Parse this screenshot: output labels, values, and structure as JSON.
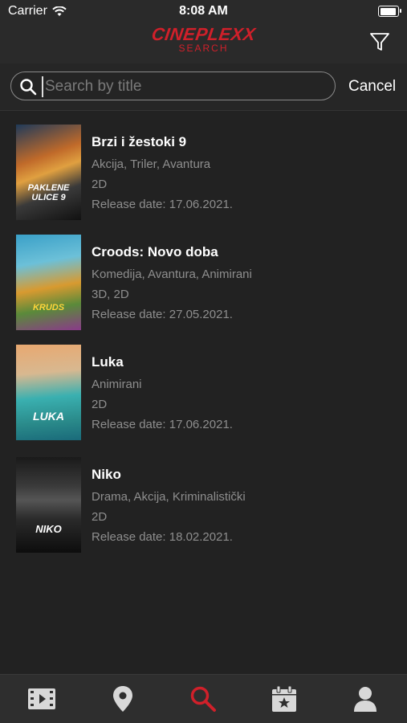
{
  "status": {
    "carrier": "Carrier",
    "time": "8:08 AM"
  },
  "header": {
    "logo": "CINEPLEXX",
    "subtitle": "SEARCH",
    "brand_color": "#d0202a",
    "filter_icon": "filter-icon"
  },
  "search": {
    "value": "",
    "placeholder": "Search by title",
    "cancel_label": "Cancel"
  },
  "movies": [
    {
      "title": "Brzi i žestoki 9",
      "genres": "Akcija, Triler, Avantura",
      "format": "2D",
      "release": "Release date: 17.06.2021.",
      "poster_text": "PAKLENE ULICE 9"
    },
    {
      "title": "Croods: Novo doba",
      "genres": "Komedija, Avantura, Animirani",
      "format": "3D, 2D",
      "release": "Release date: 27.05.2021.",
      "poster_text": "KRUDS"
    },
    {
      "title": "Luka",
      "genres": "Animirani",
      "format": "2D",
      "release": "Release date: 17.06.2021.",
      "poster_text": "LUKA"
    },
    {
      "title": "Niko",
      "genres": "Drama, Akcija, Kriminalistički",
      "format": "2D",
      "release": "Release date: 18.02.2021.",
      "poster_text": "NIKO"
    }
  ],
  "tabs": [
    {
      "icon": "film-icon",
      "active": false
    },
    {
      "icon": "location-pin-icon",
      "active": false
    },
    {
      "icon": "search-icon",
      "active": true
    },
    {
      "icon": "calendar-star-icon",
      "active": false
    },
    {
      "icon": "user-icon",
      "active": false
    }
  ],
  "colors": {
    "active_tab": "#d0202a",
    "inactive_tab": "#d8d8d8",
    "background": "#222222"
  }
}
